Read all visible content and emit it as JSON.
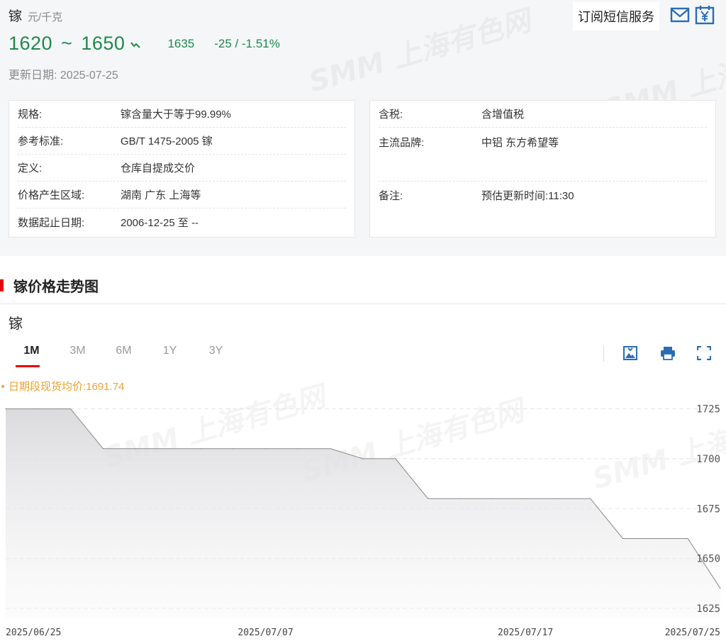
{
  "header": {
    "metal": "镓",
    "unit": "元/千克",
    "price_low": "1620",
    "price_sep": "~",
    "price_high": "1650",
    "average": "1635",
    "change": "-25 / -1.51%",
    "update_label": "更新日期:",
    "update_date": "2025-07-25",
    "subscribe_label": "订阅短信服务",
    "up_down_color": "#1e8a4c"
  },
  "spec_left": [
    {
      "key": "规格:",
      "value": "镓含量大于等于99.99%"
    },
    {
      "key": "参考标准:",
      "value": "GB/T 1475-2005 镓"
    },
    {
      "key": "定义:",
      "value": "仓库自提成交价"
    },
    {
      "key": "价格产生区域:",
      "value": "湖南 广东 上海等"
    },
    {
      "key": "数据起止日期:",
      "value": "2006-12-25 至 --"
    }
  ],
  "spec_right": [
    {
      "key": "含税:",
      "value": "含增值税"
    },
    {
      "key": "主流品牌:",
      "value": "中铝 东方希望等"
    },
    {
      "key": "备注:",
      "value": "预估更新时间:11:30"
    }
  ],
  "section": {
    "title": "镓价格走势图",
    "chart_name": "镓",
    "tabs": [
      "1M",
      "3M",
      "6M",
      "1Y",
      "3Y"
    ],
    "active_tab": "1M",
    "avg_label": "日期段现货均价:1691.74"
  },
  "watermark": "SMM 上海有色网",
  "icons": [
    "mail-icon",
    "yuan-calendar-icon",
    "download-image-icon",
    "print-icon",
    "fullscreen-icon"
  ],
  "colors": {
    "accent": "#e60012",
    "price": "#1e8a4c",
    "avg": "#f0a030",
    "icon": "#2a6db5"
  },
  "chart_data": {
    "type": "area",
    "x": [
      "2025/06/25",
      "2025/06/26",
      "2025/06/27",
      "2025/06/30",
      "2025/07/01",
      "2025/07/02",
      "2025/07/03",
      "2025/07/04",
      "2025/07/07",
      "2025/07/08",
      "2025/07/09",
      "2025/07/10",
      "2025/07/11",
      "2025/07/14",
      "2025/07/15",
      "2025/07/16",
      "2025/07/17",
      "2025/07/18",
      "2025/07/21",
      "2025/07/22",
      "2025/07/23",
      "2025/07/24",
      "2025/07/25"
    ],
    "series": [
      {
        "values": [
          1725,
          1725,
          1725,
          1705,
          1705,
          1705,
          1705,
          1705,
          1705,
          1705,
          1705,
          1700,
          1700,
          1680,
          1680,
          1680,
          1680,
          1680,
          1680,
          1660,
          1660,
          1660,
          1635
        ]
      }
    ],
    "xticks": [
      "2025/06/25",
      "2025/07/07",
      "2025/07/17",
      "2025/07/25"
    ],
    "yticks": [
      1625,
      1650,
      1675,
      1700,
      1725
    ],
    "ylim": [
      1620,
      1738
    ]
  }
}
